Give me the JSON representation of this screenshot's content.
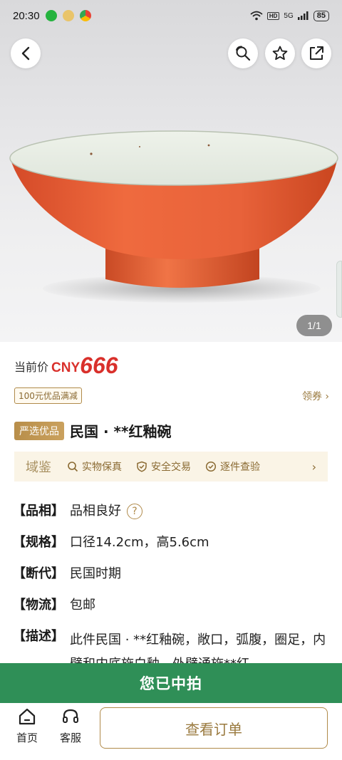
{
  "status_bar": {
    "time": "20:30",
    "network": "5G",
    "hd": "HD",
    "battery": "85"
  },
  "gallery": {
    "counter": "1/1",
    "icons": [
      "back-icon",
      "search-similar-icon",
      "star-icon",
      "share-icon"
    ]
  },
  "price": {
    "label": "当前价",
    "currency": "CNY",
    "value": "666",
    "color": "#d9302b"
  },
  "coupon": {
    "tag": "100元优品满减",
    "action": "领券 ›"
  },
  "item": {
    "badge": "严选优品",
    "title": "民国 · **红釉碗"
  },
  "assurance": {
    "brand": "域鉴",
    "items": [
      "实物保真",
      "安全交易",
      "逐件查验"
    ]
  },
  "details": [
    {
      "key": "【品相】",
      "value": "品相良好"
    },
    {
      "key": "【规格】",
      "value": "口径14.2cm，高5.6cm"
    },
    {
      "key": "【断代】",
      "value": "民国时期"
    },
    {
      "key": "【物流】",
      "value": "包邮"
    },
    {
      "key": "【描述】",
      "value": "此件民国 · **红釉碗，敞口，弧腹，圈足，内壁和内底施白釉，外壁通施**红"
    }
  ],
  "won_bar": {
    "text": "您已中拍",
    "color": "#2f8f57"
  },
  "bottom_nav": {
    "home": "首页",
    "service": "客服",
    "view_order": "查看订单"
  }
}
